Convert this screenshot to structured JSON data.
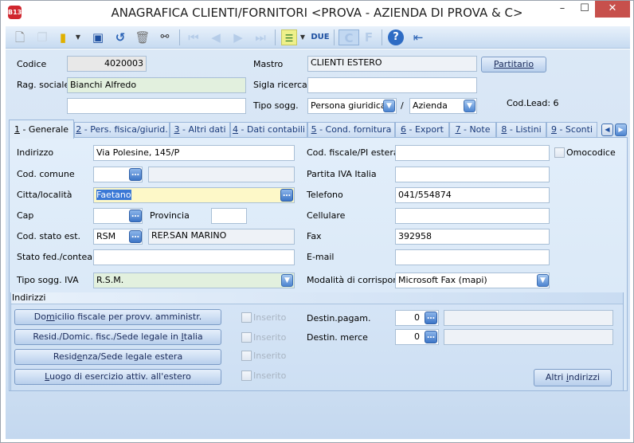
{
  "window": {
    "title": "ANAGRAFICA CLIENTI/FORNITORI <PROVA - AZIENDA DI PROVA & C>",
    "app_icon": "B13",
    "minimize": "–",
    "maximize": "☐",
    "close": "✕"
  },
  "toolbar": {
    "icons": [
      "new-document-icon",
      "copy-icon",
      "open-folder-icon",
      "save-icon",
      "undo-icon",
      "delete-icon",
      "find-binoculars-icon",
      "first-record-icon",
      "previous-record-icon",
      "next-record-icon",
      "last-record-icon",
      "list-view-icon",
      "due-icon",
      "c-icon",
      "f-icon",
      "help-icon",
      "exit-icon"
    ],
    "due_label": "DUE",
    "c_label": "C",
    "f_label": "F"
  },
  "header": {
    "codice_label": "Codice",
    "codice_value": "4020003",
    "rag_sociale_label": "Rag. sociale",
    "rag_sociale_value": "Bianchi Alfredo",
    "rag_sociale2_value": "",
    "mastro_label": "Mastro",
    "mastro_value": "CLIENTI ESTERO",
    "partitario_button": "Partitario",
    "sigla_ricerca_label": "Sigla ricerca",
    "sigla_ricerca_value": "",
    "tipo_sogg_label": "Tipo sogg.",
    "tipo_sogg_value": "Persona giuridica",
    "slash": "/",
    "tipo_sogg2_value": "Azienda",
    "cod_lead": "Cod.Lead: 6"
  },
  "tabs": [
    {
      "num": "1",
      "label": " - Generale"
    },
    {
      "num": "2",
      "label": " - Pers. fisica/giurid."
    },
    {
      "num": "3",
      "label": " - Altri dati"
    },
    {
      "num": "4",
      "label": " - Dati contabili"
    },
    {
      "num": "5",
      "label": " - Cond. fornitura"
    },
    {
      "num": "6",
      "label": " - Export"
    },
    {
      "num": "7",
      "label": " - Note"
    },
    {
      "num": "8",
      "label": " - Listini"
    },
    {
      "num": "9",
      "label": " - Sconti"
    }
  ],
  "generale": {
    "indirizzo_label": "Indirizzo",
    "indirizzo_value": "Via Polesine, 145/P",
    "cod_comune_label": "Cod. comune",
    "cod_comune_value": "",
    "cod_comune_desc": "",
    "citta_label": "Citta/località",
    "citta_value": "Faetano",
    "cap_label": "Cap",
    "cap_value": "",
    "provincia_label": "Provincia",
    "provincia_value": "",
    "cod_stato_label": "Cod. stato est.",
    "cod_stato_value": "RSM",
    "cod_stato_desc": "REP.SAN MARINO",
    "stato_fed_label": "Stato fed./contea",
    "stato_fed_value": "",
    "tipo_sogg_iva_label": "Tipo sogg. IVA",
    "tipo_sogg_iva_value": "R.S.M.",
    "cod_fiscale_label": "Cod. fiscale/PI estera",
    "cod_fiscale_value": "",
    "omocodice_label": "Omocodice",
    "partita_iva_label": "Partita IVA Italia",
    "partita_iva_value": "",
    "telefono_label": "Telefono",
    "telefono_value": "041/554874",
    "cellulare_label": "Cellulare",
    "cellulare_value": "",
    "fax_label": "Fax",
    "fax_value": "392958",
    "email_label": "E-mail",
    "email_value": "",
    "modalita_label": "Modalità di corrispond.",
    "modalita_value": "Microsoft Fax (mapi)"
  },
  "indirizzi": {
    "title": "Indirizzi",
    "buttons": [
      {
        "pre": "Do",
        "u": "m",
        "post": "icilio fiscale per provv. amministr."
      },
      {
        "pre": "Resid./Domic. fisc./Sede legale in ",
        "u": "I",
        "post": "talia"
      },
      {
        "pre": "Resid",
        "u": "e",
        "post": "nza/Sede legale estera"
      },
      {
        "pre": "",
        "u": "L",
        "post": "uogo di esercizio attiv. all'estero"
      }
    ],
    "inserito_label": "Inserito",
    "destin_pagam_label": "Destin.pagam.",
    "destin_pagam_value": "0",
    "destin_pagam_desc": "",
    "destin_merce_label": "Destin. merce",
    "destin_merce_value": "0",
    "destin_merce_desc": "",
    "altri_pre": "Altri ",
    "altri_u": "i",
    "altri_post": "ndirizzi"
  }
}
